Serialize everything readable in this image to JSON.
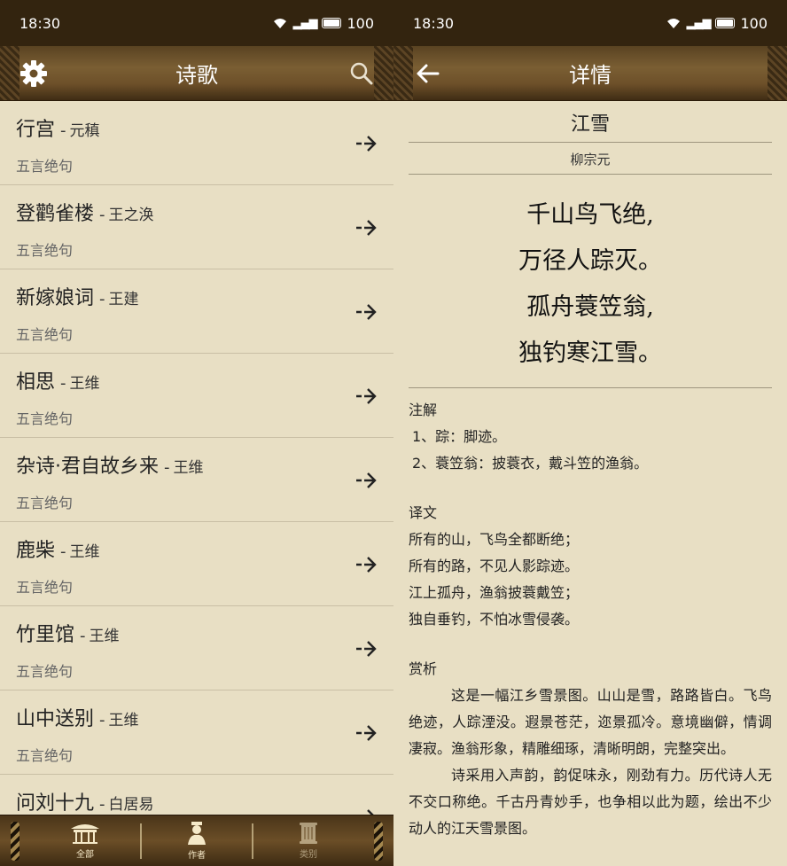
{
  "left": {
    "status": {
      "time": "18:30",
      "battery": "100"
    },
    "nav": {
      "title": "诗歌"
    },
    "list": [
      {
        "title": "行宫",
        "sep": "-",
        "author": "元稹",
        "form": "五言绝句"
      },
      {
        "title": "登鹳雀楼",
        "sep": "-",
        "author": "王之涣",
        "form": "五言绝句"
      },
      {
        "title": "新嫁娘词",
        "sep": "-",
        "author": "王建",
        "form": "五言绝句"
      },
      {
        "title": "相思",
        "sep": "-",
        "author": "王维",
        "form": "五言绝句"
      },
      {
        "title": "杂诗·君自故乡来",
        "sep": "-",
        "author": "王维",
        "form": "五言绝句"
      },
      {
        "title": "鹿柴",
        "sep": "-",
        "author": "王维",
        "form": "五言绝句"
      },
      {
        "title": "竹里馆",
        "sep": "-",
        "author": "王维",
        "form": "五言绝句"
      },
      {
        "title": "山中送别",
        "sep": "-",
        "author": "王维",
        "form": "五言绝句"
      },
      {
        "title": "问刘十九",
        "sep": "-",
        "author": "白居易",
        "form": ""
      }
    ],
    "tabs": [
      {
        "label": "全部"
      },
      {
        "label": "作者"
      },
      {
        "label": "类别"
      }
    ]
  },
  "right": {
    "status": {
      "time": "18:30",
      "battery": "100"
    },
    "nav": {
      "title": "详情"
    },
    "poem": {
      "title": "江雪",
      "author": "柳宗元",
      "lines": [
        "千山鸟飞绝,",
        "万径人踪灭。",
        "孤舟蓑笠翁,",
        "独钓寒江雪。"
      ]
    },
    "notes": {
      "title": "注解",
      "items": [
        "1、踪：脚迹。",
        "2、蓑笠翁：披蓑衣，戴斗笠的渔翁。"
      ]
    },
    "translation": {
      "title": "译文",
      "lines": [
        "所有的山，飞鸟全都断绝；",
        "所有的路，不见人影踪迹。",
        "江上孤舟，渔翁披蓑戴笠；",
        "独自垂钓，不怕冰雪侵袭。"
      ]
    },
    "appreciation": {
      "title": "赏析",
      "paragraphs": [
        "这是一幅江乡雪景图。山山是雪，路路皆白。飞鸟绝迹，人踪湮没。遐景苍茫，迩景孤冷。意境幽僻，情调凄寂。渔翁形象，精雕细琢，清晰明朗，完整突出。",
        "诗采用入声韵，韵促味永，刚劲有力。历代诗人无不交口称绝。千古丹青妙手，也争相以此为题，绘出不少动人的江天雪景图。"
      ]
    }
  }
}
